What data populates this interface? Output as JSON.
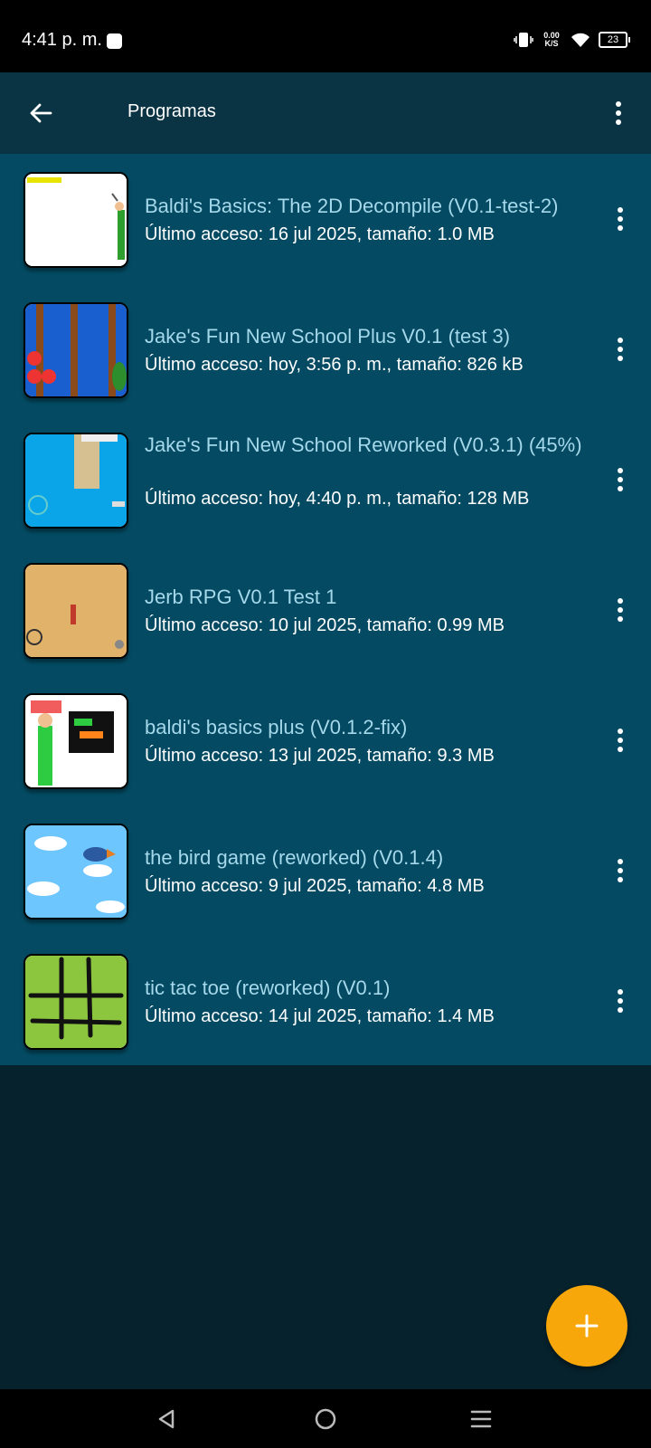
{
  "status": {
    "time": "4:41 p. m.",
    "net_speed_value": "0.00",
    "net_speed_unit": "K/S",
    "battery": "23"
  },
  "appbar": {
    "title": "Programas",
    "back_icon": "arrow-left-icon",
    "menu_icon": "more-vertical-icon"
  },
  "programs": [
    {
      "title": "Baldi's Basics: The 2D Decompile (V0.1-test-2)",
      "subtitle": "Último acceso: 16 jul 2025, tamaño: 1.0 MB"
    },
    {
      "title": "Jake's Fun New School Plus V0.1 (test 3)",
      "subtitle": "Último acceso: hoy, 3:56 p. m., tamaño: 826 kB"
    },
    {
      "title": "Jake's Fun New School Reworked (V0.3.1) (45%)",
      "subtitle": "Último acceso: hoy, 4:40 p. m., tamaño: 128 MB"
    },
    {
      "title": "Jerb RPG V0.1 Test 1",
      "subtitle": "Último acceso: 10 jul 2025, tamaño: 0.99 MB"
    },
    {
      "title": "baldi's basics plus (V0.1.2-fix)",
      "subtitle": "Último acceso: 13 jul 2025, tamaño: 9.3 MB"
    },
    {
      "title": "the bird game (reworked) (V0.1.4)",
      "subtitle": "Último acceso: 9 jul 2025, tamaño: 4.8 MB"
    },
    {
      "title": "tic tac toe (reworked) (V0.1)",
      "subtitle": "Último acceso: 14 jul 2025, tamaño: 1.4 MB"
    }
  ],
  "colors": {
    "accent": "#f8a70a",
    "list_bg": "#034a62",
    "appbar_bg": "#0a3343",
    "page_bg": "#06222d",
    "title_text": "#a5d8ea"
  }
}
